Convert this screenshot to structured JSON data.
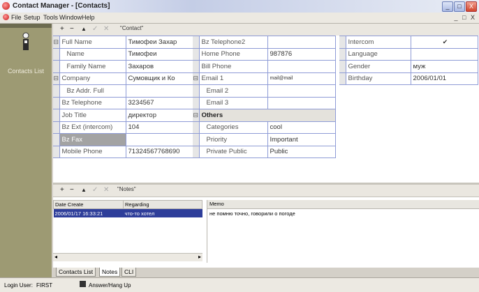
{
  "window": {
    "title": "Contact Manager - [Contacts]",
    "controls": [
      "_",
      "□",
      "X"
    ]
  },
  "menu": [
    "File",
    "Setup",
    "Tools",
    "Window",
    "Help"
  ],
  "mdi_controls": "_ □ X",
  "sidebar": {
    "label": "Contacts List"
  },
  "toolbar_top": {
    "add": "+",
    "remove": "−",
    "up": "▲",
    "check": "✓",
    "cancel": "✕",
    "title": "\"Contact\""
  },
  "grid": {
    "col1": [
      {
        "label": "Full Name",
        "value": "Тимофеи Захар",
        "expander": "⊟",
        "indent": false
      },
      {
        "label": "Name",
        "value": "Тимофеи",
        "indent": true
      },
      {
        "label": "Family Name",
        "value": "Захаров",
        "indent": true
      },
      {
        "label": "Company",
        "value": "Сумовщик и Ко",
        "expander": "⊟",
        "indent": false
      },
      {
        "label": "Bz Addr. Full",
        "value": "",
        "indent": true
      },
      {
        "label": "Bz Telephone",
        "value": "3234567",
        "indent": false
      },
      {
        "label": "Job Title",
        "value": "директор",
        "indent": false
      },
      {
        "label": "Bz Ext (intercom)",
        "value": "104",
        "indent": false
      },
      {
        "label": "Bz Fax",
        "value": "",
        "indent": false,
        "selected": true
      },
      {
        "label": "Mobile Phone",
        "value": "71324567768690",
        "indent": false
      }
    ],
    "col2": [
      {
        "label": "Bz Telephone2",
        "value": ""
      },
      {
        "label": "Home Phone",
        "value": "987876"
      },
      {
        "label": "Bill Phone",
        "value": ""
      },
      {
        "label": "Email 1",
        "value": "mail@mail",
        "expander": "⊟",
        "blue": true
      },
      {
        "label": "Email 2",
        "value": "",
        "indent": true
      },
      {
        "label": "Email 3",
        "value": "",
        "indent": true
      },
      {
        "label": "Others",
        "category": true,
        "expander": "⊟"
      },
      {
        "label": "Categories",
        "value": "cool",
        "indent": true
      },
      {
        "label": "Priority",
        "value": "Important",
        "indent": true
      },
      {
        "label": "Private Public",
        "value": "Public",
        "indent": true
      }
    ],
    "col3": [
      {
        "label": "Intercom",
        "value": "✔",
        "check": true
      },
      {
        "label": "Language",
        "value": ""
      },
      {
        "label": "Gender",
        "value": "муж"
      },
      {
        "label": "Birthday",
        "value": "2006/01/01"
      }
    ]
  },
  "toolbar_notes": {
    "add": "+",
    "remove": "−",
    "up": "▲",
    "check": "✓",
    "cancel": "✕",
    "title": "\"Notes\""
  },
  "notes": {
    "columns": [
      "Date Create",
      "Regarding"
    ],
    "rows": [
      {
        "date": "2006/01/17 16:33:21",
        "regarding": "что-то хотел"
      }
    ],
    "memo_header": "Memo",
    "memo_text": "не помню точно, говорили о погоде"
  },
  "tabs": [
    {
      "label": "Contacts List",
      "active": false
    },
    {
      "label": "Notes",
      "active": true
    },
    {
      "label": "CLI",
      "active": false
    }
  ],
  "status": {
    "login_label": "Login User:",
    "login_value": "FIRST",
    "answer_label": "Answer/Hang Up"
  }
}
